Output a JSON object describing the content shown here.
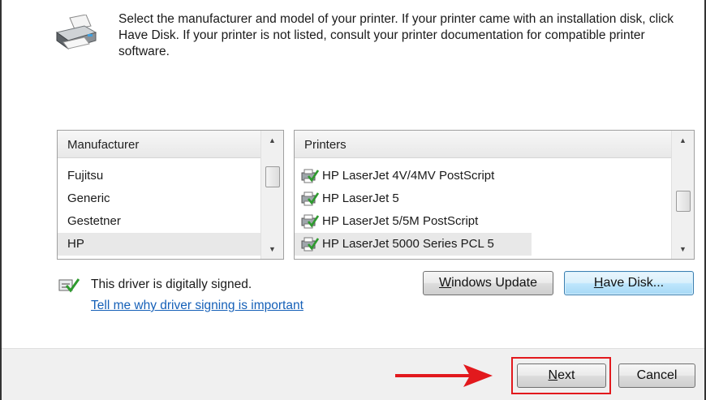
{
  "instructions": "Select the manufacturer and model of your printer. If your printer came with an installation disk, click Have Disk. If your printer is not listed, consult your printer documentation for compatible printer software.",
  "manufacturer_list": {
    "header": "Manufacturer",
    "items": [
      "Fujitsu",
      "Generic",
      "Gestetner",
      "HP"
    ],
    "selected": "HP"
  },
  "printer_list": {
    "header": "Printers",
    "items": [
      "HP LaserJet 4V/4MV PostScript",
      "HP LaserJet 5",
      "HP LaserJet 5/5M PostScript",
      "HP LaserJet 5000 Series PCL 5"
    ],
    "selected": "HP LaserJet 5000 Series PCL 5"
  },
  "signing": {
    "status_text": "This driver is digitally signed.",
    "link_text": "Tell me why driver signing is important"
  },
  "buttons": {
    "windows_update": "Windows Update",
    "have_disk": "Have Disk...",
    "next": "Next",
    "cancel": "Cancel"
  },
  "colors": {
    "accent_link": "#1560b8",
    "highlight_red": "#e2191d",
    "focused_button_border": "#3c7fb1"
  },
  "icons": {
    "header": "printer-icon",
    "printer_item": "signed-printer-driver-icon",
    "signing": "signed-driver-icon",
    "annotation": "red-arrow-icon"
  }
}
